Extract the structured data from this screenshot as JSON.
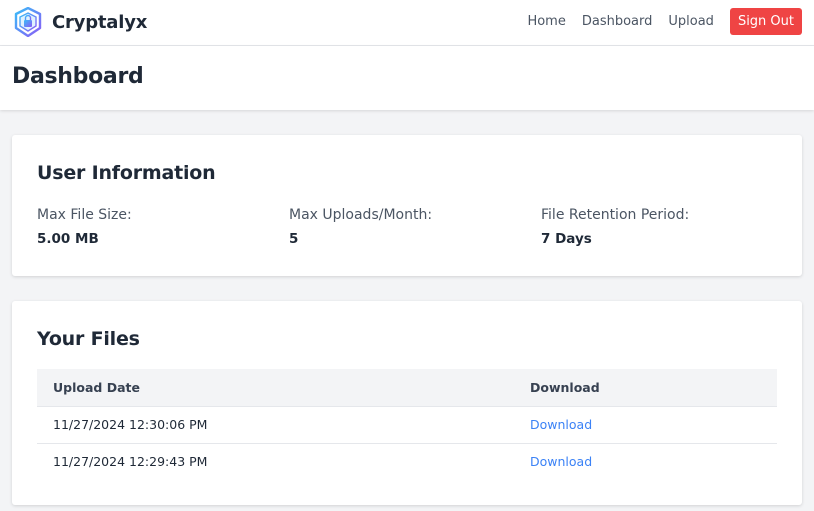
{
  "brand": {
    "name": "Cryptalyx",
    "logo_icon": "shield-lock-icon"
  },
  "nav": {
    "links": [
      {
        "label": "Home"
      },
      {
        "label": "Dashboard"
      },
      {
        "label": "Upload"
      }
    ],
    "signout_label": "Sign Out"
  },
  "header": {
    "title": "Dashboard"
  },
  "user_info": {
    "title": "User Information",
    "fields": [
      {
        "label": "Max File Size:",
        "value": "5.00 MB"
      },
      {
        "label": "Max Uploads/Month:",
        "value": "5"
      },
      {
        "label": "File Retention Period:",
        "value": "7 Days"
      }
    ]
  },
  "files": {
    "title": "Your Files",
    "columns": [
      "Upload Date",
      "Download"
    ],
    "rows": [
      {
        "date": "11/27/2024 12:30:06 PM",
        "link": "Download"
      },
      {
        "date": "11/27/2024 12:29:43 PM",
        "link": "Download"
      }
    ]
  },
  "colors": {
    "accent_danger": "#ef4444",
    "link": "#3b82f6",
    "background": "#f3f4f6"
  }
}
